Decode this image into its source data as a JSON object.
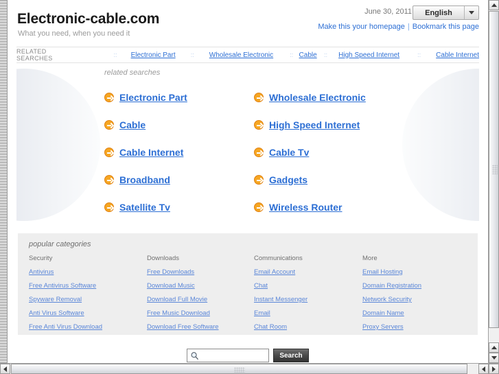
{
  "header": {
    "site_title": "Electronic-cable.com",
    "tagline": "What you need, when you need it",
    "date": "June 30, 2011",
    "language_value": "English",
    "language_arrow_icon": "chevron-down-icon",
    "homepage_link": "Make this your homepage",
    "separator": "|",
    "bookmark_link": "Bookmark this page"
  },
  "related_bar": {
    "title": "RELATED SEARCHES",
    "separator_icon": "dots-separator-icon",
    "links": [
      "Electronic Part",
      "Wholesale Electronic",
      "Cable",
      "High Speed Internet",
      "Cable Internet"
    ]
  },
  "main": {
    "heading": "related searches",
    "left_circle_icon": "decorative-semicircle-left",
    "right_circle_icon": "decorative-semicircle-right",
    "bullet_icon": "arrow-circle-right-icon",
    "links": [
      "Electronic Part",
      "Wholesale Electronic",
      "Cable",
      "High Speed Internet",
      "Cable Internet",
      "Cable Tv",
      "Broadband",
      "Gadgets",
      "Satellite Tv",
      "Wireless Router"
    ]
  },
  "categories": {
    "heading": "popular categories",
    "columns": [
      {
        "title": "Security",
        "links": [
          "Antivirus",
          "Free Antivirus Software",
          "Spyware Removal",
          "Anti Virus Software",
          "Free Anti Virus Download"
        ]
      },
      {
        "title": "Downloads",
        "links": [
          "Free Downloads",
          "Download Music",
          "Download Full Movie",
          "Free Music Download",
          "Download Free Software"
        ]
      },
      {
        "title": "Communications",
        "links": [
          "Email Account",
          "Chat",
          "Instant Messenger",
          "Email",
          "Chat Room"
        ]
      },
      {
        "title": "More",
        "links": [
          "Email Hosting",
          "Domain Registration",
          "Network Security",
          "Domain Name",
          "Proxy Servers"
        ]
      }
    ]
  },
  "search": {
    "icon": "magnifier-icon",
    "value": "",
    "placeholder": "",
    "button_label": "Search"
  },
  "scrollbars": {
    "v_up_icon": "triangle-up-icon",
    "v_down_icon": "triangle-down-icon",
    "h_left_icon": "triangle-left-icon",
    "h_right_icon": "triangle-right-icon"
  },
  "colors": {
    "link_blue": "#2d6fd4",
    "accent_orange": "#f6a623",
    "category_bg": "#eeeeee",
    "muted_text": "#9b9b9b"
  }
}
